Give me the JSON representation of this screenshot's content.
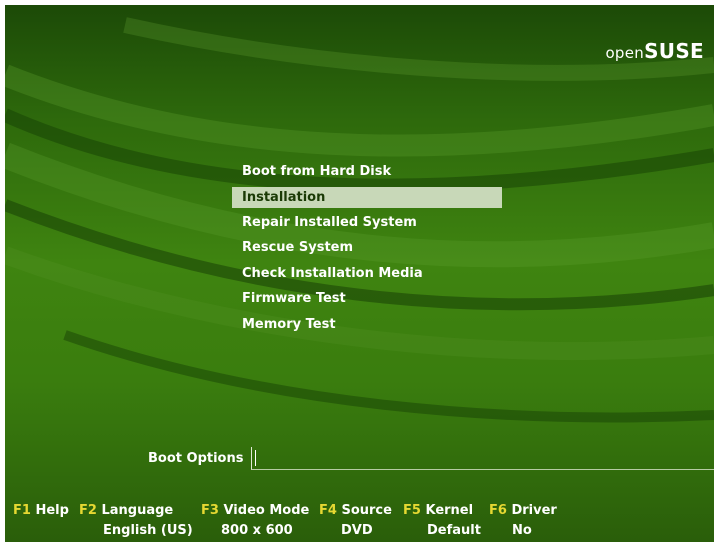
{
  "logo": {
    "prefix": "open",
    "brand": "SUSE"
  },
  "menu": {
    "items": [
      {
        "label": "Boot from Hard Disk",
        "selected": false
      },
      {
        "label": "Installation",
        "selected": true
      },
      {
        "label": "Repair Installed System",
        "selected": false
      },
      {
        "label": "Rescue System",
        "selected": false
      },
      {
        "label": "Check Installation Media",
        "selected": false
      },
      {
        "label": "Firmware Test",
        "selected": false
      },
      {
        "label": "Memory Test",
        "selected": false
      }
    ]
  },
  "boot_options": {
    "label": "Boot Options",
    "value": ""
  },
  "fkeys": [
    {
      "key": "F1",
      "label": "Help",
      "value": ""
    },
    {
      "key": "F2",
      "label": "Language",
      "value": "English (US)"
    },
    {
      "key": "F3",
      "label": "Video Mode",
      "value": "800 x 600"
    },
    {
      "key": "F4",
      "label": "Source",
      "value": "DVD"
    },
    {
      "key": "F5",
      "label": "Kernel",
      "value": "Default"
    },
    {
      "key": "F6",
      "label": "Driver",
      "value": "No"
    }
  ],
  "colors": {
    "background": "#3a7d0e",
    "selection": "#c8d8b8",
    "fkey_accent": "#e6d832",
    "text": "#ffffff"
  }
}
